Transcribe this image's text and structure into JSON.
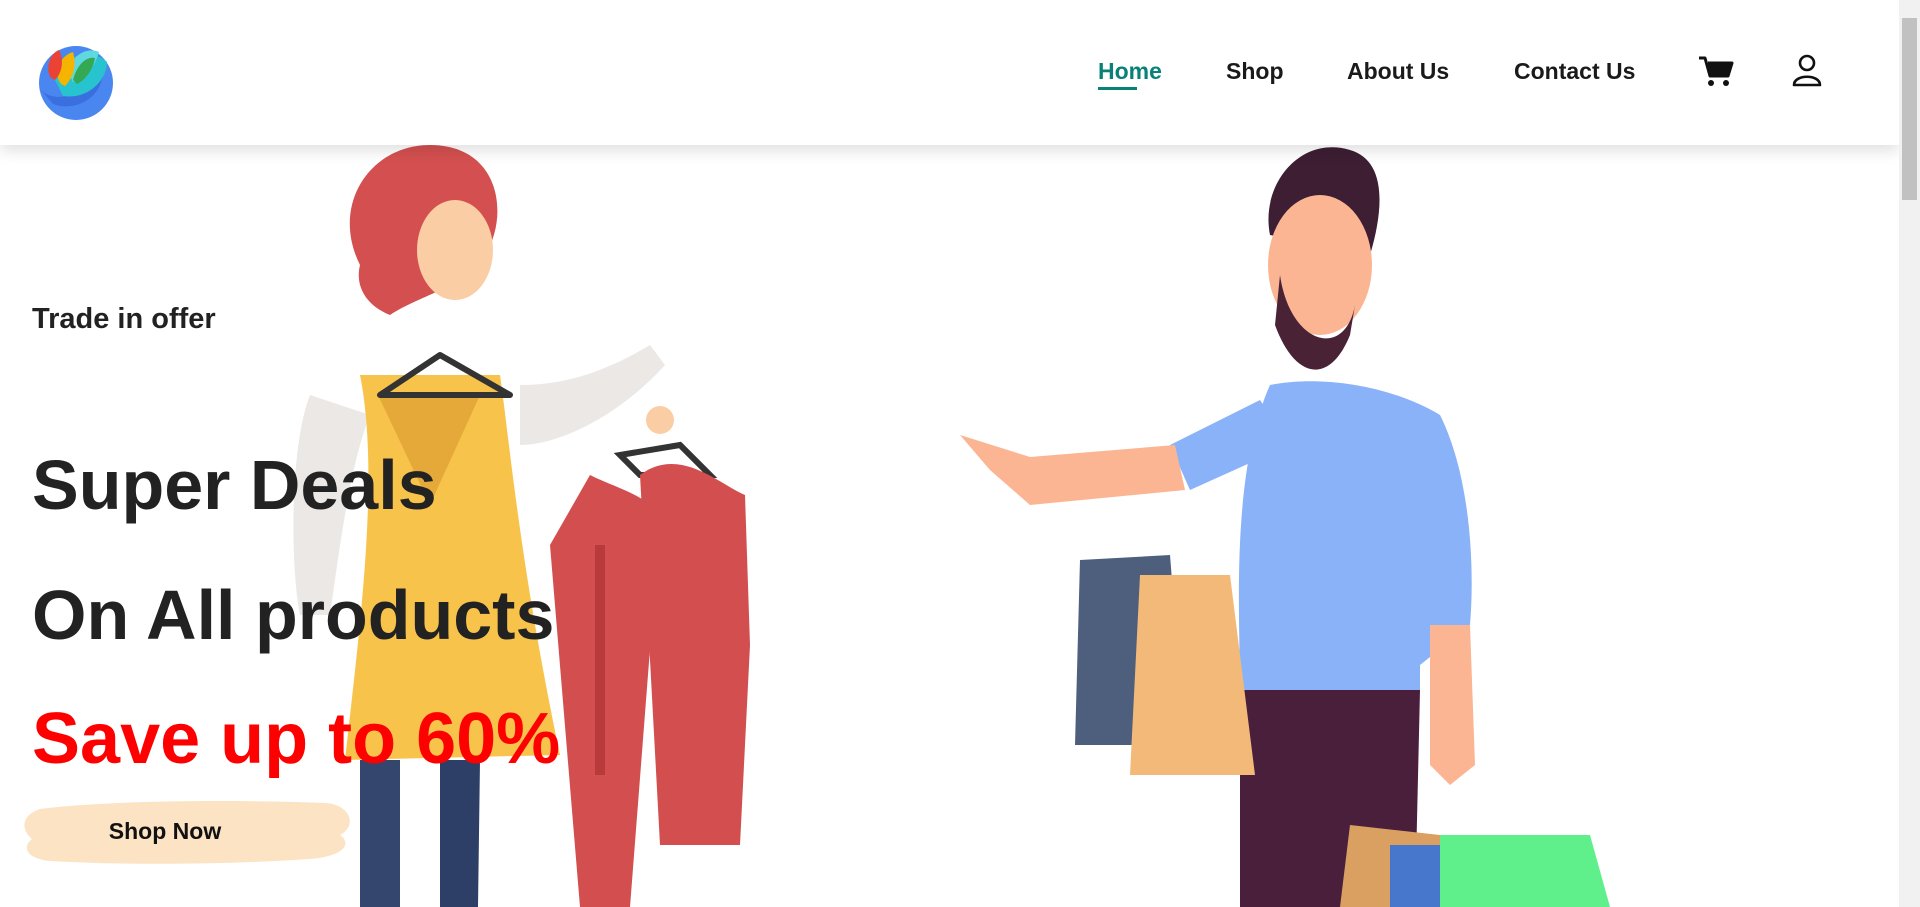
{
  "nav": {
    "links": [
      {
        "label": "Home",
        "active": true
      },
      {
        "label": "Shop",
        "active": false
      },
      {
        "label": "About Us",
        "active": false
      },
      {
        "label": "Contact Us",
        "active": false
      }
    ],
    "icons": [
      "cart-icon",
      "user-icon"
    ],
    "accent_color": "#088178"
  },
  "hero": {
    "eyebrow": "Trade in offer",
    "headline_1": "Super Deals",
    "headline_2": "On All products",
    "headline_3": "Save up to 60%",
    "cta_label": "Shop Now",
    "highlight_color": "#ff0000",
    "cta_bg_color": "#fbe3c4"
  }
}
